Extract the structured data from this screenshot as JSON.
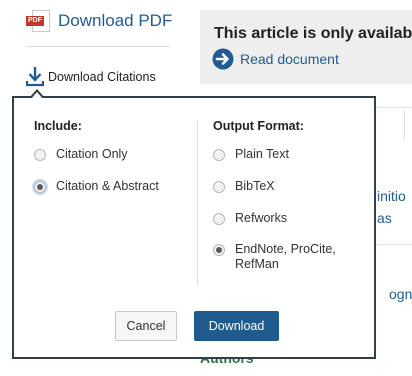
{
  "sidebar": {
    "download_pdf_label": "Download PDF",
    "pdf_badge": "PDF",
    "download_citations_label": "Download Citations"
  },
  "notice": {
    "title": "This article is only availab",
    "read_link": "Read document"
  },
  "background_fragments": {
    "frag1": "initio",
    "frag2": "as",
    "frag3": "ognit",
    "frag4": "Authors"
  },
  "dialog": {
    "include_heading": "Include:",
    "include_options": [
      {
        "label": "Citation Only",
        "selected": false
      },
      {
        "label": "Citation & Abstract",
        "selected": true
      }
    ],
    "format_heading": "Output Format:",
    "format_options": [
      {
        "label": "Plain Text",
        "selected": false
      },
      {
        "label": "BibTeX",
        "selected": false
      },
      {
        "label": "Refworks",
        "selected": false
      },
      {
        "label": "EndNote, ProCite, RefMan",
        "selected": true
      }
    ],
    "cancel_label": "Cancel",
    "download_label": "Download"
  },
  "colors": {
    "link": "#1f5c96",
    "primary_button": "#205b8e",
    "popup_border": "#2f3f4c",
    "pdf_red": "#c0392b",
    "authors_green": "#2a7a3a"
  }
}
